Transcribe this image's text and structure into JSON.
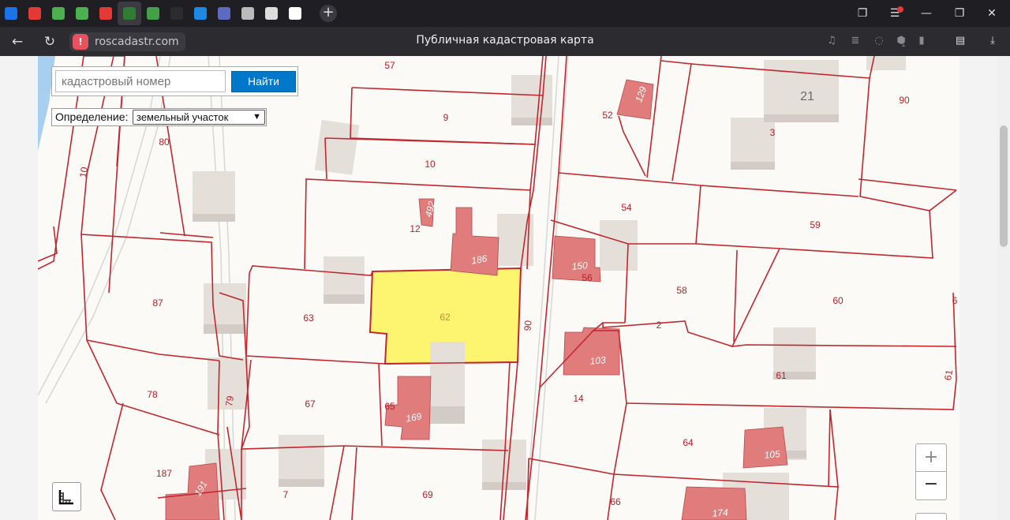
{
  "browser": {
    "tabs": [
      {
        "icon": "mail-icon",
        "color": "#1a73e8"
      },
      {
        "icon": "pokeball-icon",
        "color": "#e53935"
      },
      {
        "icon": "cluster-icon",
        "color": "#4caf50"
      },
      {
        "icon": "cluster-icon-2",
        "color": "#4caf50"
      },
      {
        "icon": "airline-icon",
        "color": "#e53935"
      },
      {
        "icon": "cadastre-icon",
        "color": "#2e7d32",
        "active": true
      },
      {
        "icon": "map-pin-icon",
        "color": "#43a047"
      },
      {
        "icon": "blank-tab-icon",
        "color": "#2b2b30"
      },
      {
        "icon": "flame-icon",
        "color": "#1e88e5"
      },
      {
        "icon": "globe-icon",
        "color": "#5c6bc0"
      },
      {
        "icon": "gear-icon",
        "color": "#bbbbbb"
      },
      {
        "icon": "document-icon",
        "color": "#dddddd"
      },
      {
        "icon": "sparkle-icon",
        "color": "#ffffff"
      }
    ],
    "url": "roscadastr.com",
    "page_title": "Публичная кадастровая карта",
    "notification_color": "#e53935",
    "downloads_badge": "1"
  },
  "search": {
    "placeholder": "кадастровый номер",
    "button_label": "Найти"
  },
  "definition": {
    "label": "Определение:",
    "selected": "земельный участок"
  },
  "zoom": {
    "in_label": "+",
    "out_label": "−"
  },
  "map": {
    "line_color": "#c1272d",
    "selected_parcel_fill": "#fdf56f",
    "building_fill": "#e07c7c",
    "labels": [
      "57",
      "9",
      "10",
      "12",
      "492",
      "186",
      "80",
      "10",
      "87",
      "63",
      "62",
      "90",
      "78",
      "79",
      "67",
      "65",
      "169",
      "187",
      "191",
      "7",
      "69",
      "52",
      "129",
      "21",
      "3",
      "90",
      "54",
      "59",
      "150",
      "56",
      "58",
      "60",
      "6",
      "2",
      "103",
      "61",
      "61",
      "14",
      "64",
      "105",
      "66",
      "174"
    ]
  }
}
